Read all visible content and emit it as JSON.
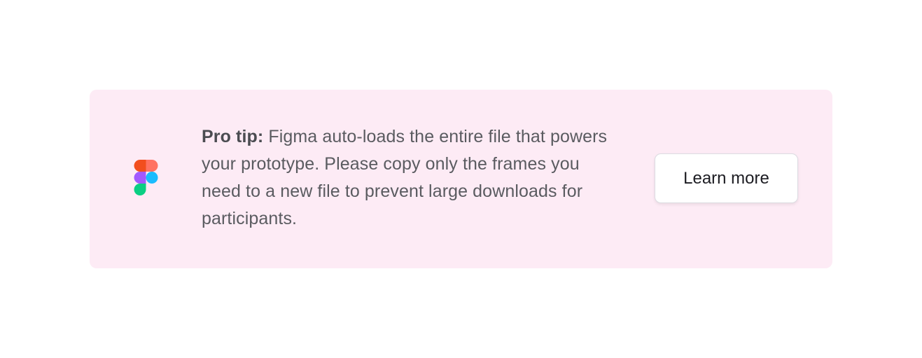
{
  "tip": {
    "lead": "Pro tip:",
    "body": " Figma auto-loads the entire file that powers your prototype. Please copy only the frames you need to a new file to prevent large downloads for participants.",
    "button_label": "Learn more",
    "icon": "figma-logo-icon"
  },
  "colors": {
    "card_background": "#fdebf5",
    "text": "#5a5b60",
    "figma_red": "#f24e1e",
    "figma_coral": "#ff7262",
    "figma_purple": "#a259ff",
    "figma_blue": "#1abcfe",
    "figma_green": "#0acf83"
  }
}
